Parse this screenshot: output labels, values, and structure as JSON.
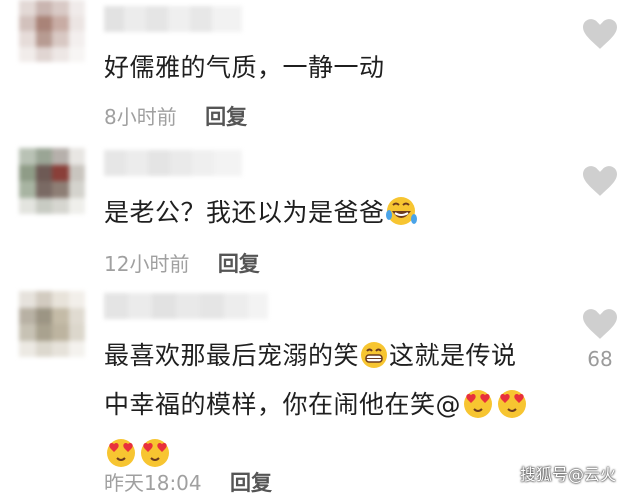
{
  "comments": [
    {
      "text": "好儒雅的气质，一静一动",
      "time": "8小时前",
      "reply_label": "回复",
      "likes": ""
    },
    {
      "text": "是老公？我还以为是爸爸",
      "time": "12小时前",
      "reply_label": "回复",
      "likes": "",
      "emoji": "rofl-emoji"
    },
    {
      "text_line1": "最喜欢那最后宠溺的笑",
      "text_line1b": "这就是传说",
      "text_line2": "中幸福的模样，你在闹他在笑@",
      "time": "昨天18:04",
      "reply_label": "回复",
      "likes": "68",
      "emojis": [
        "grin-emoji",
        "heart-eyes-emoji"
      ]
    }
  ],
  "watermark": "搜狐号@云火",
  "colors": {
    "heart": "#cfcfcf",
    "text": "#1f1f1f",
    "meta": "#a0a0a0",
    "emoji": "#f7c531"
  }
}
